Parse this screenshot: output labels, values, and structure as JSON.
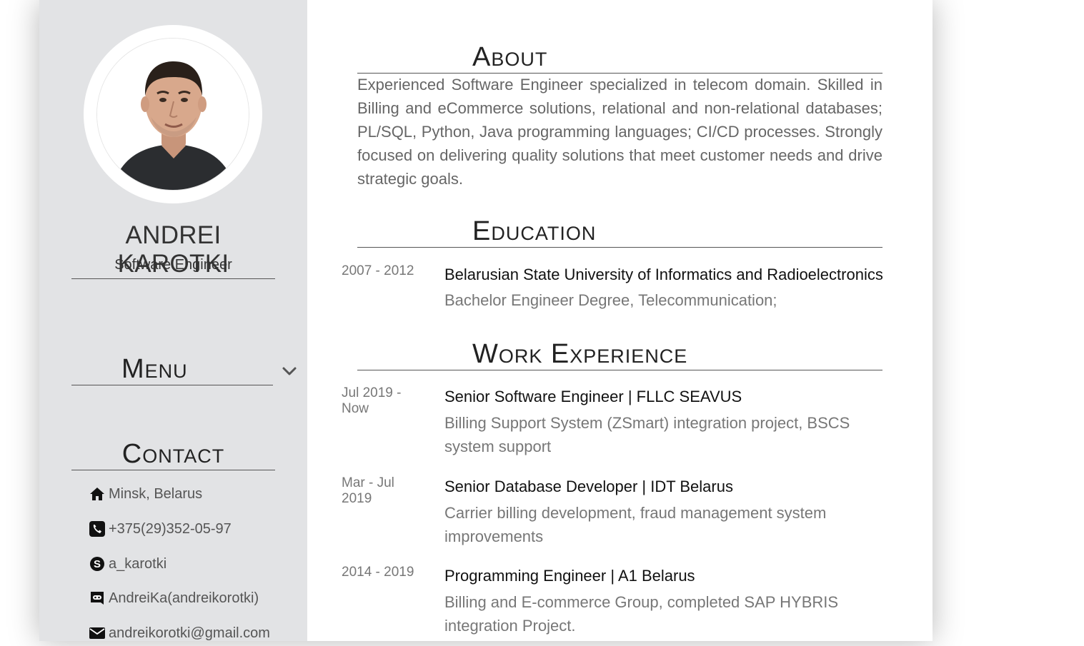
{
  "profile": {
    "name": "ANDREI KAROTKI",
    "role": "Software Engineer"
  },
  "menu": {
    "heading": "Menu",
    "toggle_icon": "chevron-down-icon"
  },
  "contact": {
    "heading": "Contact",
    "items": [
      {
        "icon": "home-icon",
        "text": "Minsk, Belarus"
      },
      {
        "icon": "phone-icon",
        "text": "+375(29)352-05-97"
      },
      {
        "icon": "skype-icon",
        "text": "a_karotki"
      },
      {
        "icon": "discord-icon",
        "text": "AndreiKa(andreikorotki)"
      },
      {
        "icon": "mail-icon",
        "text": "andreikorotki@gmail.com"
      }
    ]
  },
  "about": {
    "heading": "About",
    "text": "Experienced Software Engineer specialized in telecom domain. Skilled in Billing and eCommerce solutions, relational and non-relational databases; PL/SQL, Python, Java programming languages; CI/CD processes. Strongly focused on delivering quality solutions that meet customer needs and drive strategic goals."
  },
  "education": {
    "heading": "Education",
    "items": [
      {
        "date": "2007 - 2012",
        "title": "Belarusian State University of Informatics and Radioelectronics",
        "desc": "Bachelor Engineer Degree, Telecommunication;"
      }
    ]
  },
  "work": {
    "heading": "Work Experience",
    "items": [
      {
        "date": "Jul 2019 - Now",
        "title": "Senior Software Engineer | FLLC SEAVUS",
        "desc": "Billing Support System (ZSmart) integration project, BSCS system support"
      },
      {
        "date": "Mar - Jul 2019",
        "title": "Senior Database Developer | IDT Belarus",
        "desc": "Carrier billing development, fraud management system improvements"
      },
      {
        "date": "2014 - 2019",
        "title": "Programming Engineer | A1 Belarus",
        "desc": "Billing and E-commerce Group, completed SAP HYBRIS integration Project."
      }
    ]
  }
}
